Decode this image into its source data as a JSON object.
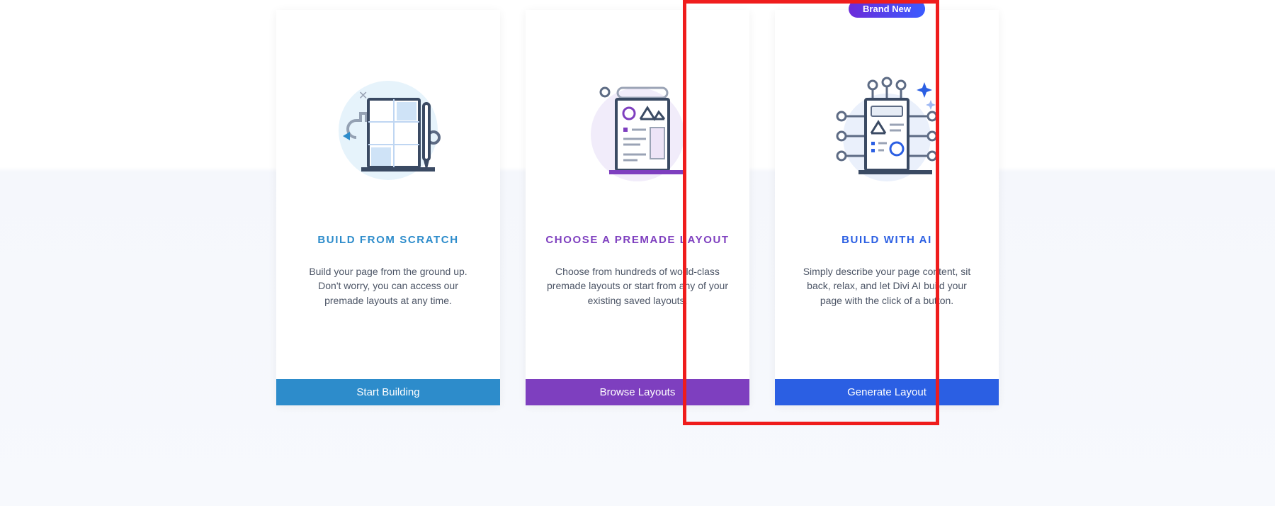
{
  "badge": {
    "label": "Brand New"
  },
  "cards": {
    "scratch": {
      "title": "BUILD FROM SCRATCH",
      "description": "Build your page from the ground up. Don't worry, you can access our premade layouts at any time.",
      "cta": "Start Building"
    },
    "premade": {
      "title": "CHOOSE A PREMADE LAYOUT",
      "description": "Choose from hundreds of world-class premade layouts or start from any of your existing saved layouts.",
      "cta": "Browse Layouts"
    },
    "ai": {
      "title": "BUILD WITH AI",
      "description": "Simply describe your page content, sit back, relax, and let Divi AI build your page with the click of a button.",
      "cta": "Generate Layout"
    }
  }
}
